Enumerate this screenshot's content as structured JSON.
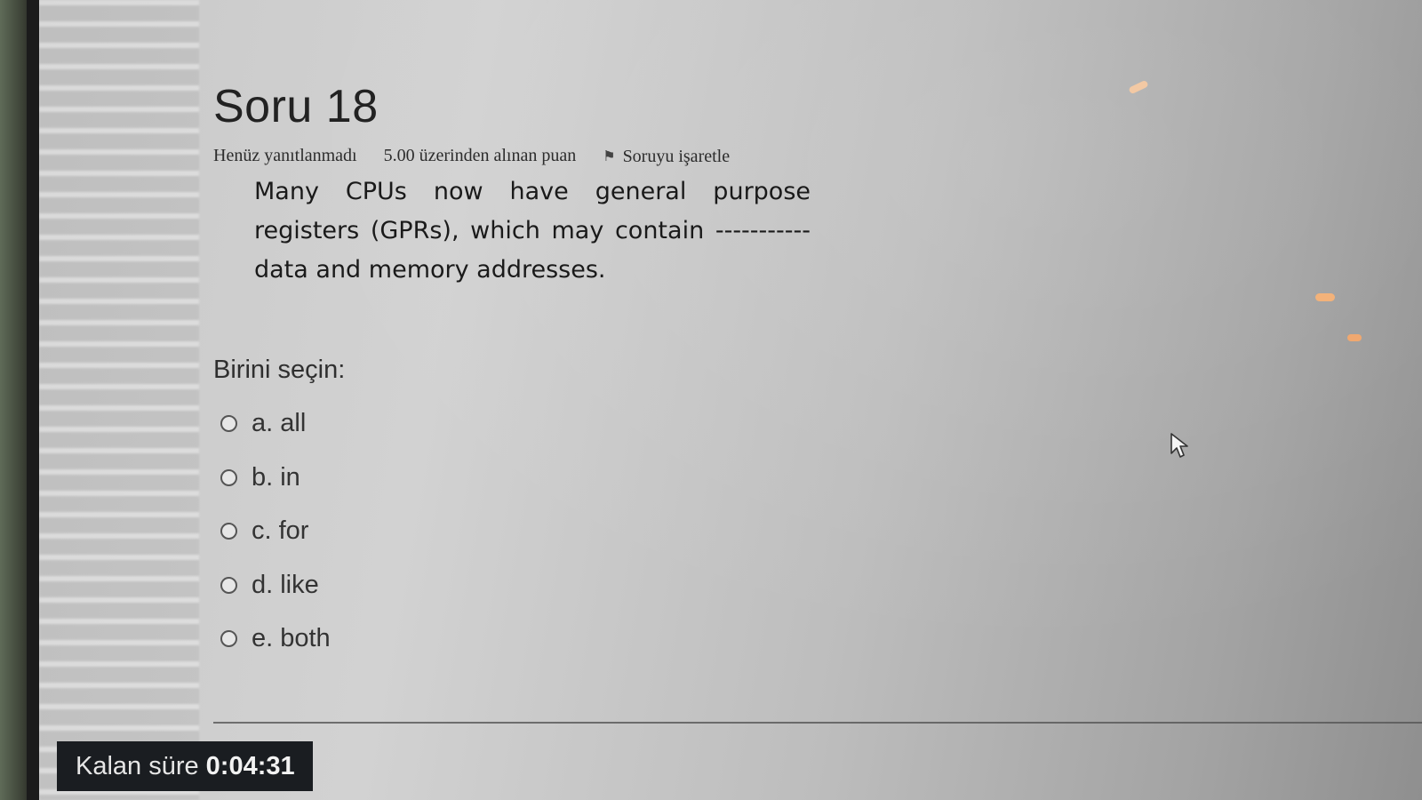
{
  "question": {
    "title": "Soru 18",
    "status": "Henüz yanıtlanmadı",
    "points": "5.00 üzerinden alınan puan",
    "flag_label": "Soruyu işaretle",
    "text": "Many CPUs now have general purpose registers (GPRs), which may contain ----------- data and memory addresses.",
    "choose_label": "Birini seçin:",
    "options": [
      {
        "label": "a. all"
      },
      {
        "label": "b. in"
      },
      {
        "label": "c. for"
      },
      {
        "label": "d. like"
      },
      {
        "label": "e. both"
      }
    ]
  },
  "timer": {
    "label": "Kalan süre",
    "value": "0:04:31"
  },
  "icons": {
    "flag": "flag-icon",
    "cursor": "mouse-pointer-icon",
    "radio": "radio-unselected-icon"
  }
}
